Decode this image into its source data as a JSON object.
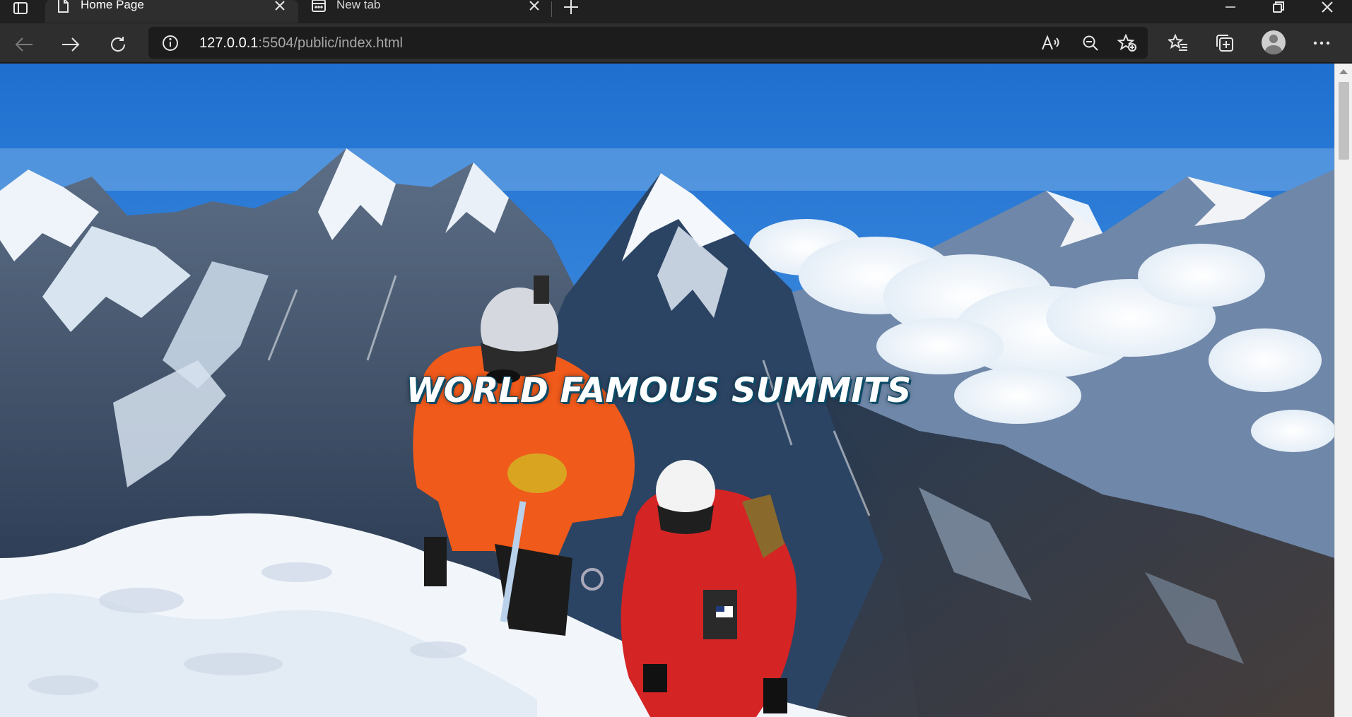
{
  "browser": {
    "tabs": [
      {
        "title": "Home Page",
        "active": true,
        "icon": "page-icon"
      },
      {
        "title": "New tab",
        "active": false,
        "icon": "newtab-page-icon"
      }
    ],
    "address": {
      "host": "127.0.0.1",
      "port_path": ":5504/public/index.html"
    }
  },
  "page": {
    "hero_title": "WORLD FAMOUS SUMMITS",
    "hero_image": "mountain-climbers-summit-photo"
  },
  "colors": {
    "sky_top": "#1f6fd0",
    "sky_bottom": "#7fb6ea",
    "title_outline": "#0b4a66",
    "jacket_orange": "#f05a1a",
    "jacket_red": "#d42424"
  }
}
